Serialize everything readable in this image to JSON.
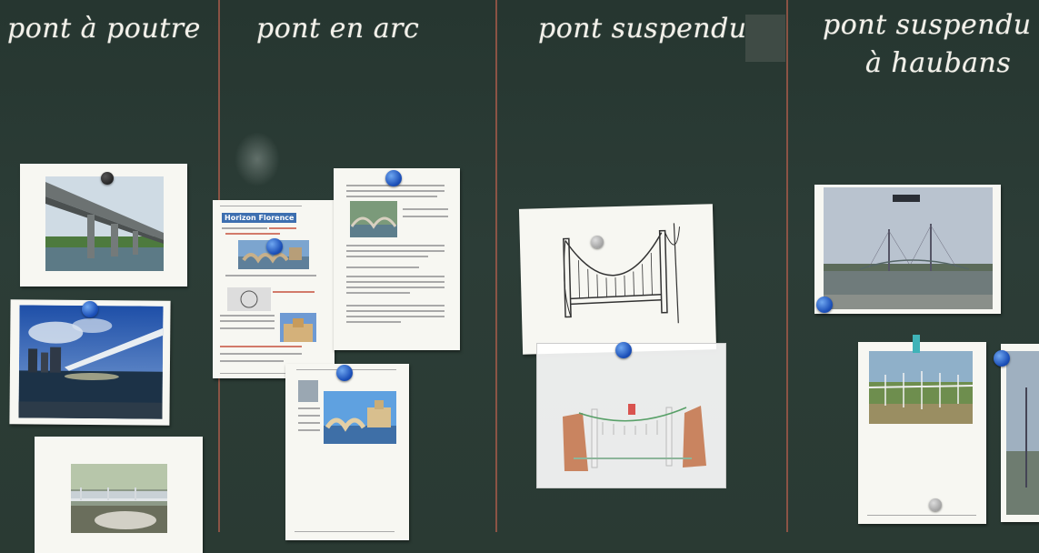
{
  "headings": [
    {
      "text": "pont à poutre"
    },
    {
      "text": "pont en arc"
    },
    {
      "text": "pont suspendu"
    },
    {
      "line1": "pont suspendu",
      "line2": "à haubans"
    }
  ],
  "document": {
    "title": "Horizon Florence"
  },
  "colors": {
    "board": "#2a3a34",
    "divider": "#a45a4a",
    "magnet": "#1b4fb8",
    "chalk": "#f3f1ea"
  }
}
